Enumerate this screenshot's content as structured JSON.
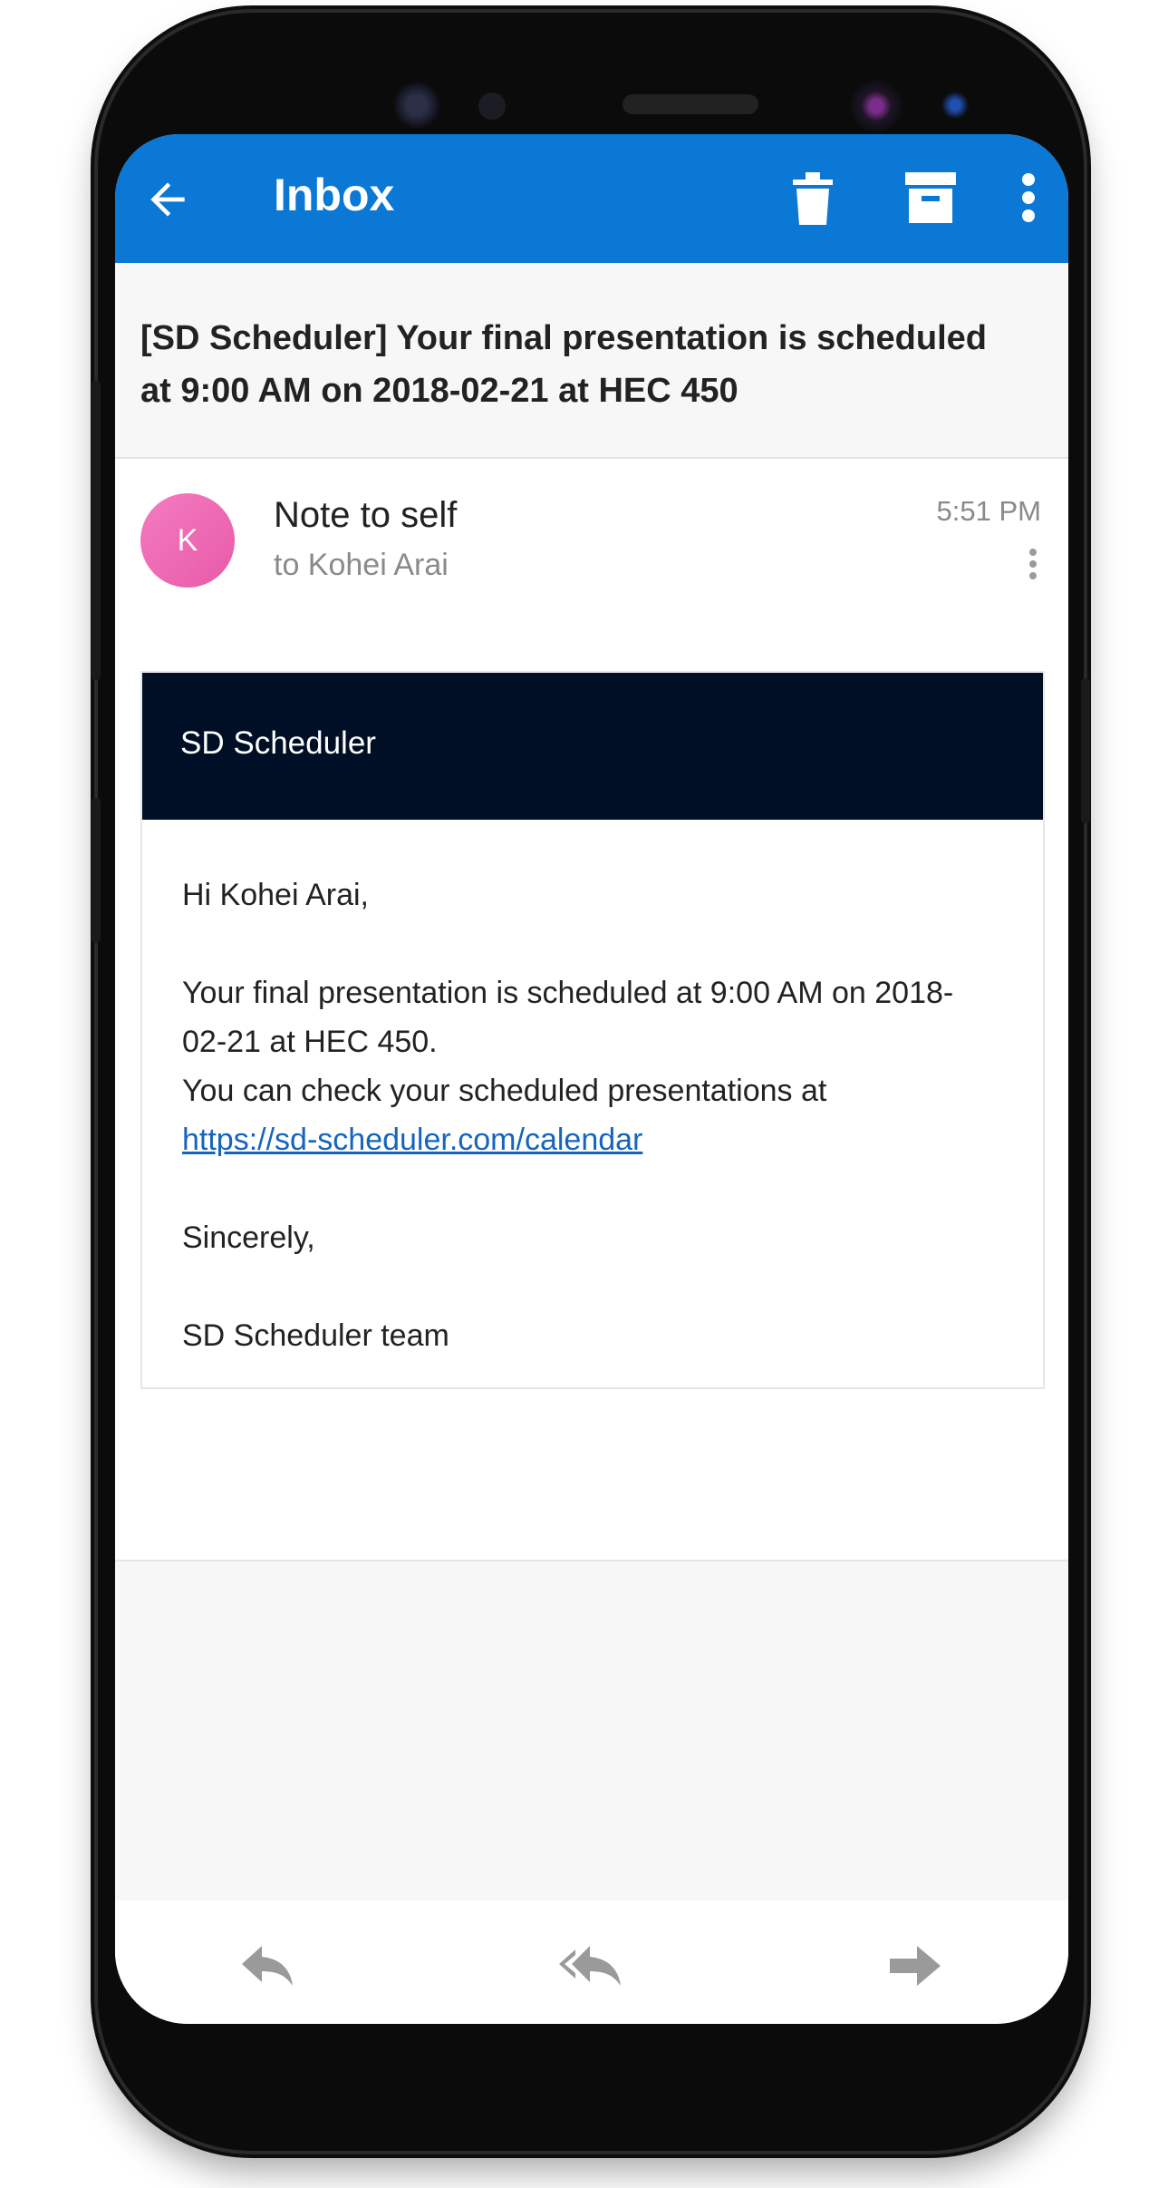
{
  "appbar": {
    "title": "Inbox",
    "icons": [
      "back-arrow-icon",
      "trash-icon",
      "archive-icon",
      "more-vert-icon"
    ],
    "color": "#0a78d4"
  },
  "email": {
    "subject": "[SD Scheduler] Your final presentation is scheduled at 9:00 AM on 2018-02-21 at HEC 450",
    "avatar_letter": "K",
    "sender": "Note to self",
    "recipient": "to Kohei Arai",
    "time": "5:51 PM",
    "banner_title": "SD Scheduler",
    "greeting": "Hi Kohei Arai,",
    "body_line1": "Your final presentation is scheduled at 9:00 AM on 2018-02-21 at HEC 450.",
    "body_line2": "You can check your scheduled presentations at",
    "link": "https://sd-scheduler.com/calendar",
    "closing": "Sincerely,",
    "signature": "SD Scheduler team"
  },
  "bottombar": {
    "icons": [
      "reply-icon",
      "reply-all-icon",
      "forward-icon"
    ]
  }
}
